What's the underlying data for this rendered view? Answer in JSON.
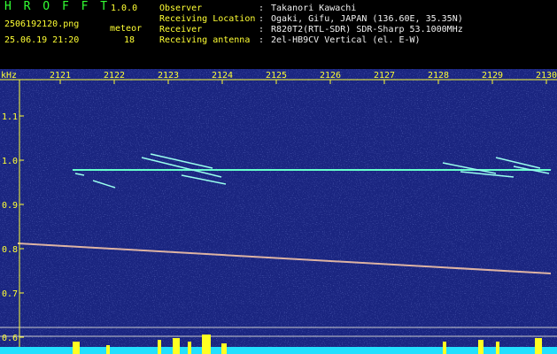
{
  "header": {
    "app_name": "H R O F F T",
    "version": "1.0.0",
    "filename": "2506192120.png",
    "meteor_label": "meteor",
    "datetime": "25.06.19 21:20",
    "meteor_count": "18",
    "info": [
      {
        "label": "Observer",
        "value": "Takanori Kawachi"
      },
      {
        "label": "Receiving Location",
        "value": "Ogaki, Gifu, JAPAN (136.60E, 35.35N)"
      },
      {
        "label": "Receiver",
        "value": "R820T2(RTL-SDR) SDR-Sharp 53.1000MHz"
      },
      {
        "label": "Receiving antenna",
        "value": "2el-HB9CV Vertical (el. E-W)"
      }
    ]
  },
  "spectrogram": {
    "unit_label": "kHz",
    "time_ticks": [
      "2121",
      "2122",
      "2123",
      "2124",
      "2125",
      "2126",
      "2127",
      "2128",
      "2129",
      "2130"
    ],
    "freq_ticks": [
      "1.1",
      "1.0",
      "0.9",
      "0.8",
      "0.7",
      "0.6"
    ],
    "colors": {
      "background": "#1a2580",
      "axis": "#ffff33",
      "carrier": "#66ffcc",
      "level": "#22e0ff",
      "burst": "#ffff22"
    }
  }
}
